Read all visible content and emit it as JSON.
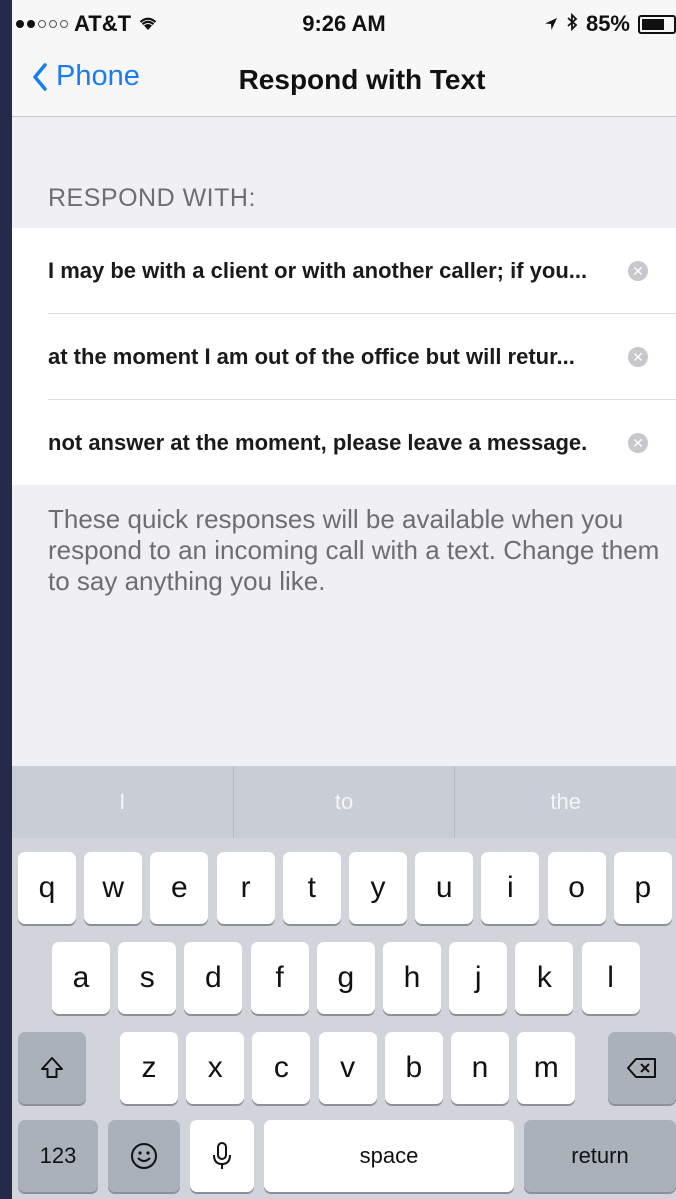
{
  "status_bar": {
    "carrier": "AT&T",
    "time": "9:26 AM",
    "battery": "85%",
    "battery_level": 0.85
  },
  "nav": {
    "back_label": "Phone",
    "title": "Respond with Text"
  },
  "section_header": "RESPOND WITH:",
  "responses": [
    "I may be with a client or with another caller; if you...",
    "at the moment I am out of the office but will retur...",
    "not answer at the moment, please leave a message."
  ],
  "footer_text": "These quick responses will be available when you respond to an incoming call with a text. Change them to say anything you like.",
  "keyboard": {
    "predictions": [
      "I",
      "to",
      "the"
    ],
    "row1": [
      "q",
      "w",
      "e",
      "r",
      "t",
      "y",
      "u",
      "i",
      "o",
      "p"
    ],
    "row2": [
      "a",
      "s",
      "d",
      "f",
      "g",
      "h",
      "j",
      "k",
      "l"
    ],
    "row3": [
      "z",
      "x",
      "c",
      "v",
      "b",
      "n",
      "m"
    ],
    "numbers_label": "123",
    "space_label": "space",
    "return_label": "return"
  },
  "colors": {
    "accent": "#1a7cf5",
    "background": "#efeff4"
  }
}
